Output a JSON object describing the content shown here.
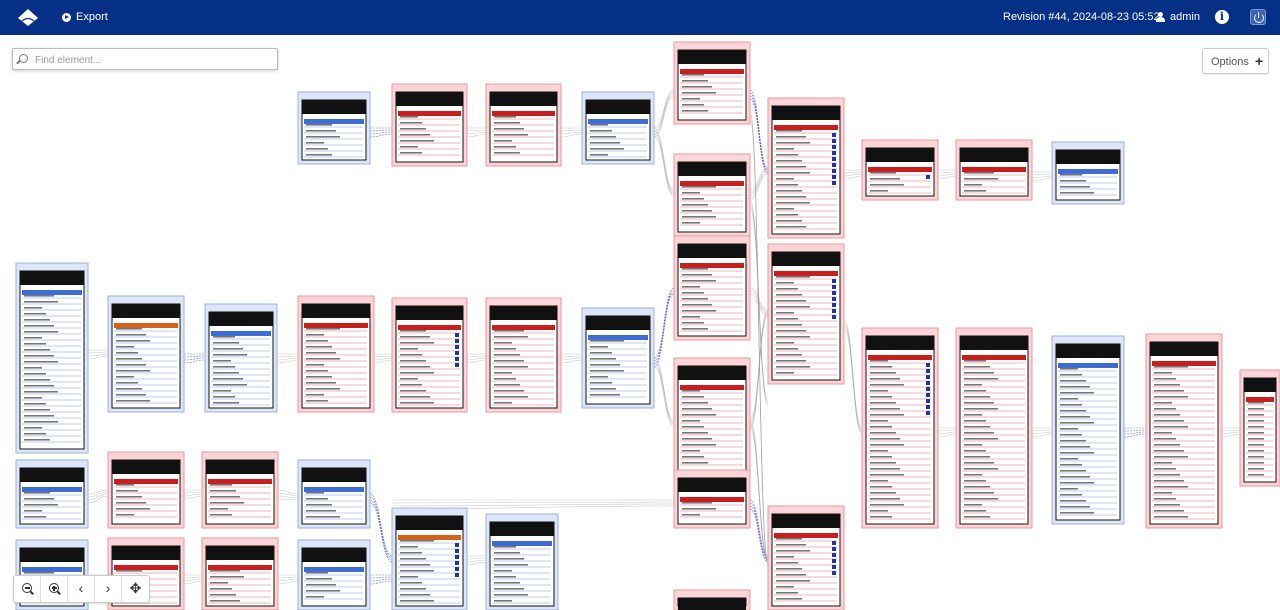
{
  "header": {
    "export_label": "Export",
    "revision_label": "Revision #44, 2024-08-23 05:52",
    "user_label": "admin",
    "bg_color": "#063085"
  },
  "search": {
    "placeholder": "Find element..."
  },
  "options": {
    "label": "Options"
  },
  "zoom_controls": [
    "zoom-out",
    "zoom-in",
    "back",
    "forward",
    "fit"
  ],
  "colors": {
    "table_pink": "#fdd4d7",
    "table_blue": "#dce6f8",
    "header_black": "#111111",
    "key_red": "#c81e1e",
    "key_blue": "#3f6bd6",
    "key_orange": "#d4621c",
    "link_blue": "#3b3bd9",
    "link_gray": "#9a9a9a"
  }
}
